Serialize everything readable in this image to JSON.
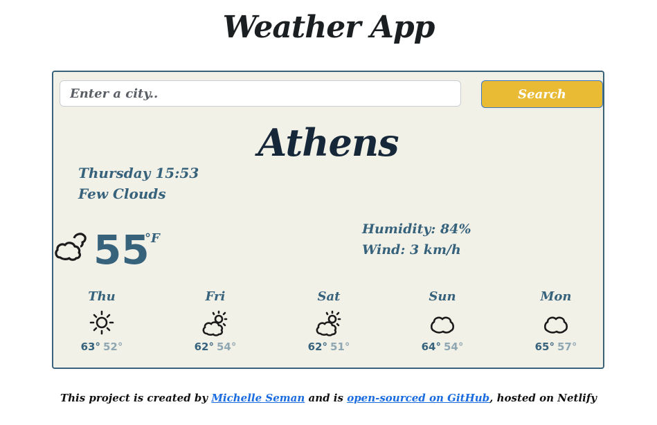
{
  "header": {
    "title": "Weather App"
  },
  "search": {
    "placeholder": "Enter a city..",
    "value": "",
    "button_label": "Search"
  },
  "current": {
    "city": "Athens",
    "date": "Thursday 15:53",
    "description": "Few Clouds",
    "icon": "few-clouds-icon",
    "temperature": "55",
    "unit": "°F",
    "humidity_label": "Humidity: 84%",
    "wind_label": "Wind: 3 km/h"
  },
  "forecast": [
    {
      "day": "Thu",
      "icon": "sun-icon",
      "max": "63°",
      "min": "52°"
    },
    {
      "day": "Fri",
      "icon": "partly-cloudy-icon",
      "max": "62°",
      "min": "54°"
    },
    {
      "day": "Sat",
      "icon": "partly-cloudy-icon",
      "max": "62°",
      "min": "51°"
    },
    {
      "day": "Sun",
      "icon": "cloud-icon",
      "max": "64°",
      "min": "54°"
    },
    {
      "day": "Mon",
      "icon": "cloud-icon",
      "max": "65°",
      "min": "57°"
    }
  ],
  "footer": {
    "text_1": "This project is created by ",
    "author_link": "Michelle Seman",
    "text_2": " and is ",
    "github_link": "open-sourced on GitHub",
    "text_3": ", hosted on Netlify"
  }
}
